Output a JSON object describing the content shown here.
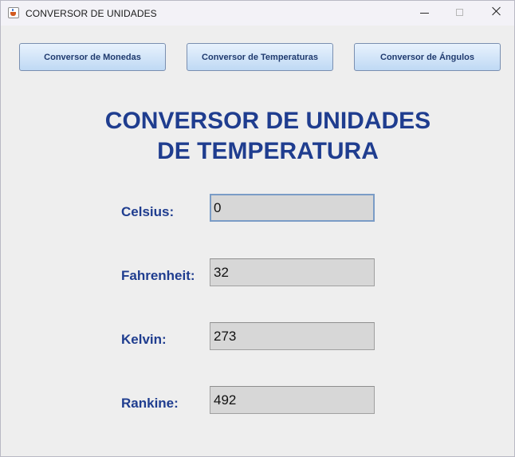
{
  "window": {
    "title": "CONVERSOR DE UNIDADES",
    "icon": "java-cup-icon",
    "controls": [
      "minimize",
      "maximize",
      "close"
    ]
  },
  "nav": {
    "currency_label": "Conversor de Monedas",
    "temperature_label": "Conversor de Temperaturas",
    "angles_label": "Conversor de Ángulos"
  },
  "heading": {
    "line1": "CONVERSOR DE UNIDADES",
    "line2": "DE TEMPERATURA"
  },
  "fields": {
    "celsius": {
      "label": "Celsius:",
      "value": "0"
    },
    "fahrenheit": {
      "label": "Fahrenheit:",
      "value": "32"
    },
    "kelvin": {
      "label": "Kelvin:",
      "value": "273"
    },
    "rankine": {
      "label": "Rankine:",
      "value": "492"
    }
  },
  "colors": {
    "heading": "#1f3d8f",
    "button_text": "#1f3a6e",
    "button_bg": "#bfd9f4",
    "window_bg": "#eeeeee",
    "input_bg": "#d7d7d7"
  }
}
